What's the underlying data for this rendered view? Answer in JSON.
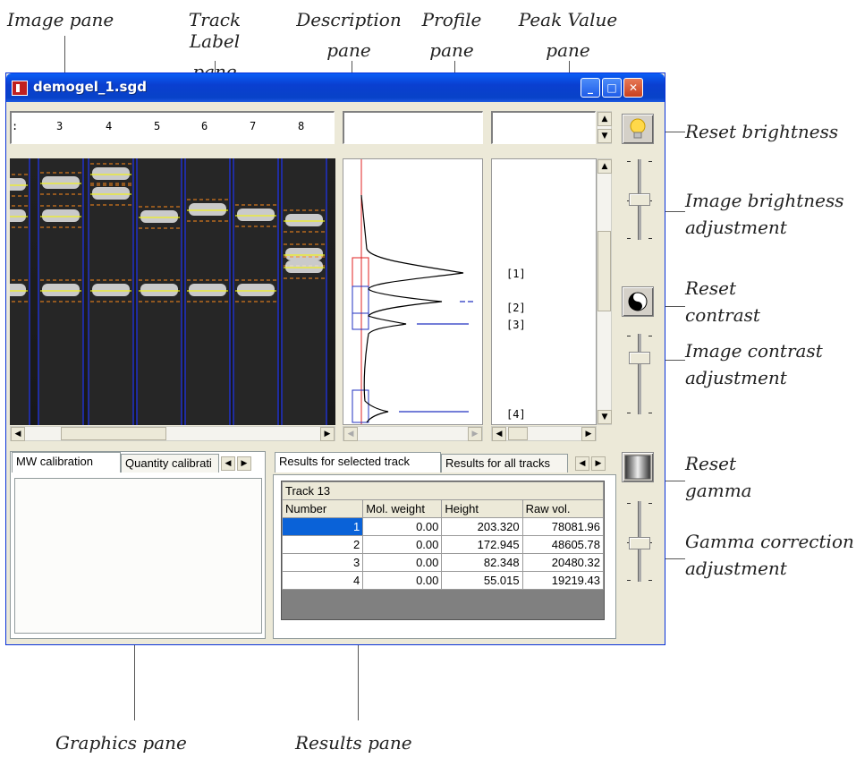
{
  "callouts": {
    "image_pane": "Image pane",
    "track_label_1": "Track Label",
    "track_label_2": "pane",
    "description_1": "Description",
    "description_2": "pane",
    "profile_1": "Profile",
    "profile_2": "pane",
    "peak_value_1": "Peak Value",
    "peak_value_2": "pane",
    "reset_brightness": "Reset brightness",
    "image_brightness_1": "Image brightness",
    "image_brightness_2": "adjustment",
    "reset_contrast_1": "Reset",
    "reset_contrast_2": "contrast",
    "image_contrast_1": "Image contrast",
    "image_contrast_2": "adjustment",
    "reset_gamma_1": "Reset",
    "reset_gamma_2": "gamma",
    "gamma_1": "Gamma correction",
    "gamma_2": "adjustment",
    "graphics_pane": "Graphics pane",
    "results_pane": "Results pane"
  },
  "window": {
    "title": "demogel_1.sgd",
    "minimize": "_",
    "maximize": "□",
    "close": "✕"
  },
  "track_labels": [
    ":",
    "3",
    "4",
    "5",
    "6",
    "7",
    "8"
  ],
  "peak_labels": [
    "[1]",
    "[2]",
    "[3]",
    "[4]"
  ],
  "graphics_tabs": {
    "tab1": "MW calibration",
    "tab2": "Quantity calibrati"
  },
  "results_tabs": {
    "tab1": "Results for selected track",
    "tab2": "Results for all tracks"
  },
  "results": {
    "track_title": "Track 13",
    "columns": [
      "Number",
      "Mol. weight",
      "Height",
      "Raw vol."
    ],
    "rows": [
      [
        "1",
        "0.00",
        "203.320",
        "78081.96"
      ],
      [
        "2",
        "0.00",
        "172.945",
        "48605.78"
      ],
      [
        "3",
        "0.00",
        "82.348",
        "20480.32"
      ],
      [
        "4",
        "0.00",
        "55.015",
        "19219.43"
      ]
    ]
  },
  "icons": {
    "brightness": "lightbulb-icon",
    "contrast": "yin-yang-icon",
    "gamma": "gradient-icon"
  },
  "colors": {
    "title_bar": "#0a4fe0",
    "lane_border": "#2030c0",
    "band_line": "#f0f020",
    "band_limits": "#ff8a1a",
    "profile_box_red": "#e02020",
    "selected_row": "#0a62d8"
  }
}
